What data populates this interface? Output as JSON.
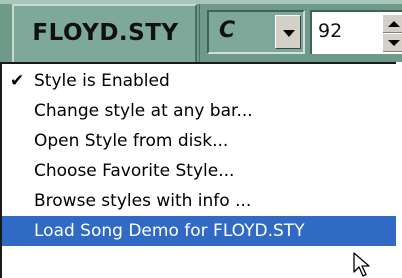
{
  "toolbar": {
    "style_name": "FLOYD.STY",
    "key": "C",
    "tempo": "92"
  },
  "menu": {
    "items": [
      {
        "label": "Style is Enabled",
        "checked": true
      },
      {
        "label": "Change style at any bar...",
        "checked": false
      },
      {
        "label": "Open Style from disk...",
        "checked": false
      },
      {
        "label": "Choose Favorite Style...",
        "checked": false
      },
      {
        "label": "Browse styles with info ...",
        "checked": false
      },
      {
        "label": "Load Song Demo for FLOYD.STY",
        "checked": false,
        "highlighted": true
      }
    ],
    "check_mark": "✔"
  },
  "colors": {
    "toolbar_bg": "#6f9a8a",
    "panel_bg": "#7ea99a",
    "highlight": "#316ac5",
    "menu_bg": "#ffffff"
  },
  "icons": {
    "check": "check-icon",
    "key_dropdown": "chevron-down-icon",
    "tempo_up": "arrow-up-icon",
    "tempo_down": "arrow-down-icon",
    "pointer": "mouse-pointer-icon"
  }
}
